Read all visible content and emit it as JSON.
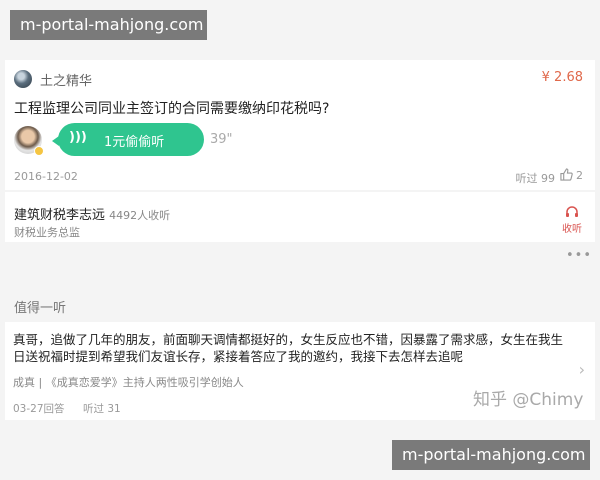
{
  "watermark": {
    "top": "m-portal-mahjong.com",
    "bottom": "m-portal-mahjong.com"
  },
  "question_card": {
    "asker_name": "土之精华",
    "price": "¥ 2.68",
    "question": "工程监理公司同业主签订的合同需要缴纳印花税吗?",
    "listen_button_label": "1元偷偷听",
    "duration": "39\"",
    "date": "2016-12-02",
    "listen_count": "听过 99",
    "like_count": "2"
  },
  "expert_card": {
    "name": "建筑财税李志远",
    "followers": "4492人收听",
    "title": "财税业务总监",
    "follow_label": "收听"
  },
  "recommend_section": {
    "title": "值得一听",
    "item": {
      "text": "真哥，追做了几年的朋友，前面聊天调情都挺好的，女生反应也不错，因暴露了需求感，女生在我生日送祝福时提到希望我们友谊长存，紧接着答应了我的邀约，我接下去怎样去追呢",
      "author": "成真 | 《成真恋爱学》主持人两性吸引学创始人",
      "date": "03-27回答",
      "listens": "听过 31"
    }
  },
  "zhihu_watermark": "知乎 @Chimy",
  "colors": {
    "accent_green": "#2fc58f",
    "price_orange": "#e0694b",
    "follow_red": "#d9534f"
  },
  "icons": [
    "sound-wave-icon",
    "thumbs-up-icon",
    "headset-icon",
    "more-icon",
    "chevron-right-icon"
  ]
}
